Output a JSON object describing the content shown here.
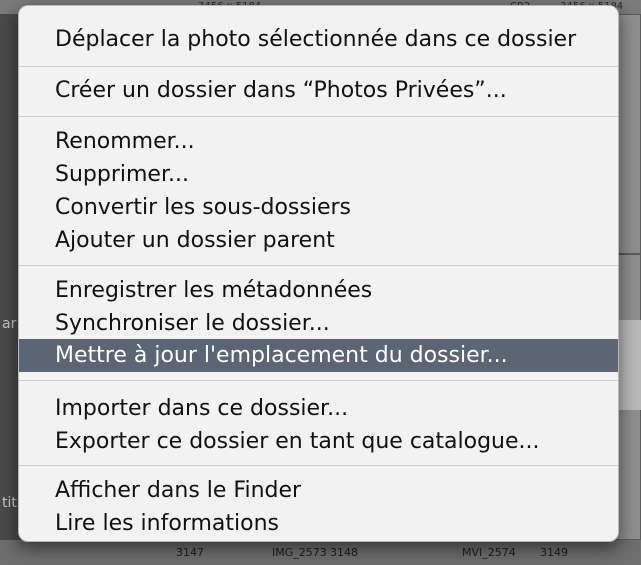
{
  "background": {
    "top_labels": [
      "3456 x 5184",
      "CR2",
      "3456 x 5184"
    ],
    "left_labels": [
      "ar",
      "titl"
    ],
    "bottom_numbers": [
      "3147",
      "IMG_2573",
      "3148",
      "MVI_2574",
      "3149"
    ]
  },
  "menu": {
    "groups": [
      {
        "items": [
          {
            "label": "Déplacer la photo sélectionnée dans ce dossier"
          }
        ]
      },
      {
        "items": [
          {
            "label": "Créer un dossier dans “Photos Privées”..."
          }
        ]
      },
      {
        "items": [
          {
            "label": "Renommer..."
          },
          {
            "label": "Supprimer..."
          },
          {
            "label": "Convertir les sous-dossiers"
          },
          {
            "label": "Ajouter un dossier parent"
          }
        ]
      },
      {
        "items": [
          {
            "label": "Enregistrer les métadonnées"
          },
          {
            "label": "Synchroniser le dossier..."
          },
          {
            "label": "Mettre à jour l'emplacement du dossier...",
            "highlighted": true
          }
        ]
      },
      {
        "items": [
          {
            "label": "Importer dans ce dossier..."
          },
          {
            "label": "Exporter ce dossier en tant que catalogue..."
          }
        ]
      },
      {
        "items": [
          {
            "label": "Afficher dans le Finder"
          },
          {
            "label": "Lire les informations"
          }
        ]
      }
    ],
    "highlight_color": "#5b6574"
  }
}
